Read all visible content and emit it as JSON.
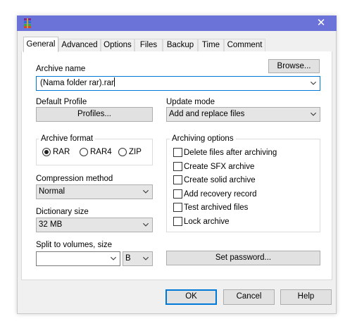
{
  "window": {
    "close_glyph": "✕",
    "accent": "#0078d7",
    "titlebar_color": "#6b73d8"
  },
  "tabs": [
    {
      "label": "General",
      "active": true
    },
    {
      "label": "Advanced"
    },
    {
      "label": "Options"
    },
    {
      "label": "Files"
    },
    {
      "label": "Backup"
    },
    {
      "label": "Time"
    },
    {
      "label": "Comment"
    }
  ],
  "archive_name": {
    "label": "Archive name",
    "browse_label": "Browse...",
    "value": "(Nama folder rar).rar"
  },
  "default_profile": {
    "label": "Default Profile",
    "button_label": "Profiles..."
  },
  "update_mode": {
    "label": "Update mode",
    "value": "Add and replace files"
  },
  "archive_format": {
    "title": "Archive format",
    "options": [
      {
        "label": "RAR",
        "selected": true
      },
      {
        "label": "RAR4",
        "selected": false
      },
      {
        "label": "ZIP",
        "selected": false
      }
    ]
  },
  "archiving_options": {
    "title": "Archiving options",
    "items": [
      {
        "label": "Delete files after archiving",
        "checked": false
      },
      {
        "label": "Create SFX archive",
        "checked": false
      },
      {
        "label": "Create solid archive",
        "checked": false
      },
      {
        "label": "Add recovery record",
        "checked": false
      },
      {
        "label": "Test archived files",
        "checked": false
      },
      {
        "label": "Lock archive",
        "checked": false
      }
    ]
  },
  "compression": {
    "label": "Compression method",
    "value": "Normal"
  },
  "dictionary": {
    "label": "Dictionary size",
    "value": "32 MB"
  },
  "split": {
    "label": "Split to volumes, size",
    "value": "",
    "unit": "B"
  },
  "set_password_label": "Set password...",
  "footer": {
    "ok": "OK",
    "cancel": "Cancel",
    "help": "Help"
  }
}
